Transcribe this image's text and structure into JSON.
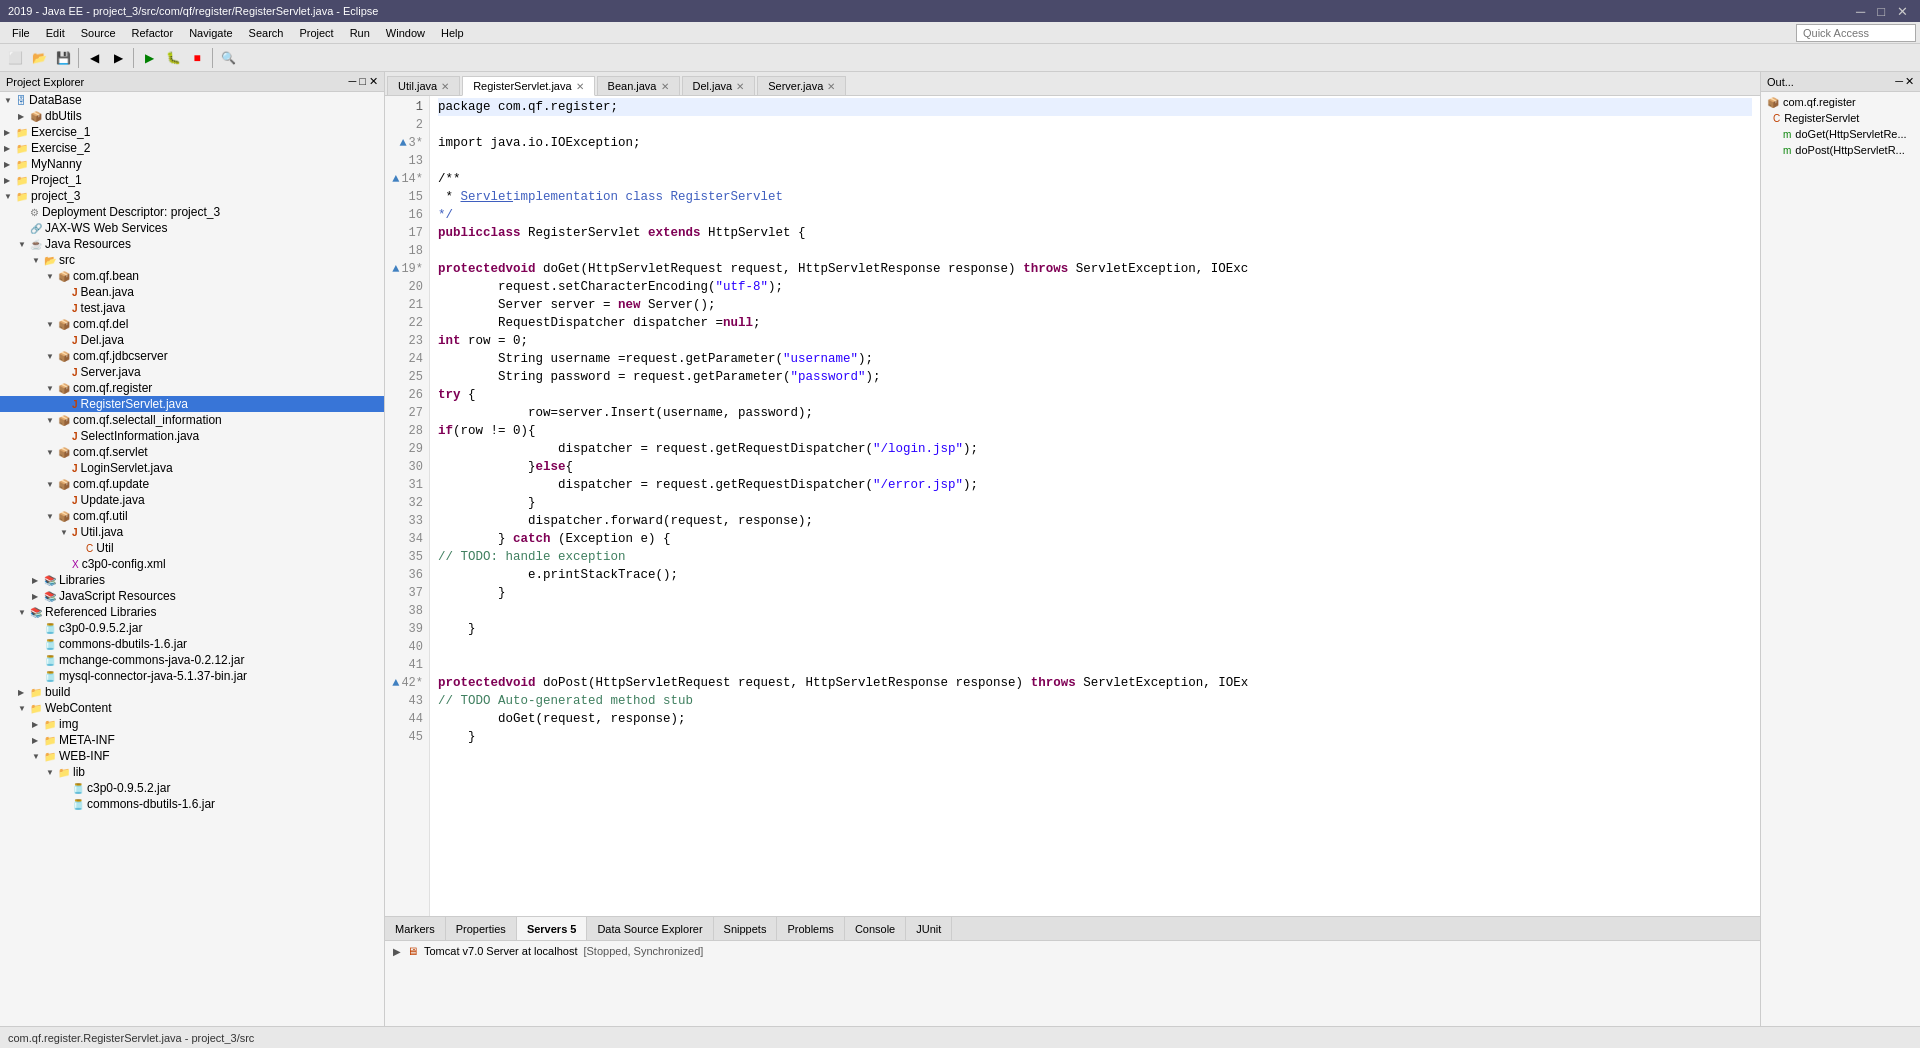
{
  "titleBar": {
    "title": "2019 - Java EE - project_3/src/com/qf/register/RegisterServlet.java - Eclipse",
    "controls": [
      "─",
      "□",
      "✕"
    ]
  },
  "menuBar": {
    "items": [
      "File",
      "Edit",
      "Source",
      "Refactor",
      "Navigate",
      "Search",
      "Project",
      "Run",
      "Window",
      "Help"
    ]
  },
  "quickAccess": {
    "placeholder": "Quick Access"
  },
  "editorTabs": [
    {
      "label": "Util.java",
      "active": false,
      "dirty": false
    },
    {
      "label": "RegisterServlet.java",
      "active": true,
      "dirty": false
    },
    {
      "label": "Bean.java",
      "active": false,
      "dirty": false
    },
    {
      "label": "Del.java",
      "active": false,
      "dirty": false
    },
    {
      "label": "Server.java",
      "active": false,
      "dirty": false
    }
  ],
  "leftPanelTitle": "Project Explorer",
  "projectTree": [
    {
      "indent": 1,
      "arrow": "▼",
      "icon": "db",
      "label": "DataBase",
      "level": 1
    },
    {
      "indent": 2,
      "arrow": "▶",
      "icon": "pkg",
      "label": "dbUtils",
      "level": 2
    },
    {
      "indent": 1,
      "arrow": "▶",
      "icon": "proj",
      "label": "Exercise_1",
      "level": 1
    },
    {
      "indent": 1,
      "arrow": "▶",
      "icon": "proj",
      "label": "Exercise_2",
      "level": 1
    },
    {
      "indent": 1,
      "arrow": "▶",
      "icon": "proj",
      "label": "MyNanny",
      "level": 1
    },
    {
      "indent": 1,
      "arrow": "▶",
      "icon": "proj",
      "label": "Project_1",
      "level": 1
    },
    {
      "indent": 1,
      "arrow": "▼",
      "icon": "proj",
      "label": "project_3",
      "level": 1
    },
    {
      "indent": 2,
      "arrow": " ",
      "icon": "dd",
      "label": "Deployment Descriptor: project_3",
      "level": 2
    },
    {
      "indent": 2,
      "arrow": " ",
      "icon": "ws",
      "label": "JAX-WS Web Services",
      "level": 2
    },
    {
      "indent": 2,
      "arrow": "▼",
      "icon": "jr",
      "label": "Java Resources",
      "level": 2
    },
    {
      "indent": 3,
      "arrow": "▼",
      "icon": "src",
      "label": "src",
      "level": 3
    },
    {
      "indent": 4,
      "arrow": "▼",
      "icon": "pkg",
      "label": "com.qf.bean",
      "level": 4
    },
    {
      "indent": 5,
      "arrow": " ",
      "icon": "java",
      "label": "Bean.java",
      "level": 5
    },
    {
      "indent": 5,
      "arrow": " ",
      "icon": "java",
      "label": "test.java",
      "level": 5
    },
    {
      "indent": 4,
      "arrow": "▼",
      "icon": "pkg",
      "label": "com.qf.del",
      "level": 4
    },
    {
      "indent": 5,
      "arrow": " ",
      "icon": "java",
      "label": "Del.java",
      "level": 5
    },
    {
      "indent": 4,
      "arrow": "▼",
      "icon": "pkg",
      "label": "com.qf.jdbcserver",
      "level": 4
    },
    {
      "indent": 5,
      "arrow": " ",
      "icon": "java",
      "label": "Server.java",
      "level": 5
    },
    {
      "indent": 4,
      "arrow": "▼",
      "icon": "pkg",
      "label": "com.qf.register",
      "level": 4
    },
    {
      "indent": 5,
      "arrow": " ",
      "icon": "java",
      "label": "RegisterServlet.java",
      "level": 5,
      "selected": true
    },
    {
      "indent": 4,
      "arrow": "▼",
      "icon": "pkg",
      "label": "com.qf.selectall_information",
      "level": 4
    },
    {
      "indent": 5,
      "arrow": " ",
      "icon": "java",
      "label": "SelectInformation.java",
      "level": 5
    },
    {
      "indent": 4,
      "arrow": "▼",
      "icon": "pkg",
      "label": "com.qf.servlet",
      "level": 4
    },
    {
      "indent": 5,
      "arrow": " ",
      "icon": "java",
      "label": "LoginServlet.java",
      "level": 5
    },
    {
      "indent": 4,
      "arrow": "▼",
      "icon": "pkg",
      "label": "com.qf.update",
      "level": 4
    },
    {
      "indent": 5,
      "arrow": " ",
      "icon": "java",
      "label": "Update.java",
      "level": 5
    },
    {
      "indent": 4,
      "arrow": "▼",
      "icon": "pkg",
      "label": "com.qf.util",
      "level": 4
    },
    {
      "indent": 5,
      "arrow": "▼",
      "icon": "java",
      "label": "Util.java",
      "level": 5
    },
    {
      "indent": 6,
      "arrow": " ",
      "icon": "cls",
      "label": "Util",
      "level": 6
    },
    {
      "indent": 5,
      "arrow": " ",
      "icon": "xml",
      "label": "c3p0-config.xml",
      "level": 5
    },
    {
      "indent": 3,
      "arrow": "▶",
      "icon": "lib",
      "label": "Libraries",
      "level": 3
    },
    {
      "indent": 3,
      "arrow": "▶",
      "icon": "lib",
      "label": "JavaScript Resources",
      "level": 3
    },
    {
      "indent": 2,
      "arrow": "▼",
      "icon": "reflib",
      "label": "Referenced Libraries",
      "level": 2
    },
    {
      "indent": 3,
      "arrow": " ",
      "icon": "jar",
      "label": "c3p0-0.9.5.2.jar",
      "level": 3
    },
    {
      "indent": 3,
      "arrow": " ",
      "icon": "jar",
      "label": "commons-dbutils-1.6.jar",
      "level": 3
    },
    {
      "indent": 3,
      "arrow": " ",
      "icon": "jar",
      "label": "mchange-commons-java-0.2.12.jar",
      "level": 3
    },
    {
      "indent": 3,
      "arrow": " ",
      "icon": "jar",
      "label": "mysql-connector-java-5.1.37-bin.jar",
      "level": 3
    },
    {
      "indent": 2,
      "arrow": "▶",
      "icon": "folder",
      "label": "build",
      "level": 2
    },
    {
      "indent": 2,
      "arrow": "▼",
      "icon": "folder",
      "label": "WebContent",
      "level": 2
    },
    {
      "indent": 3,
      "arrow": "▶",
      "icon": "folder",
      "label": "img",
      "level": 3
    },
    {
      "indent": 3,
      "arrow": "▶",
      "icon": "folder",
      "label": "META-INF",
      "level": 3
    },
    {
      "indent": 3,
      "arrow": "▼",
      "icon": "folder",
      "label": "WEB-INF",
      "level": 3
    },
    {
      "indent": 4,
      "arrow": "▼",
      "icon": "folder",
      "label": "lib",
      "level": 4
    },
    {
      "indent": 5,
      "arrow": " ",
      "icon": "jar",
      "label": "c3p0-0.9.5.2.jar",
      "level": 5
    },
    {
      "indent": 5,
      "arrow": " ",
      "icon": "jar",
      "label": "commons-dbutils-1.6.jar",
      "level": 5
    }
  ],
  "codeLines": [
    {
      "num": 1,
      "text": "package com.qf.register;",
      "highlight": true
    },
    {
      "num": 2,
      "text": ""
    },
    {
      "num": 3,
      "text": "import java.io.IOException;",
      "fold": true
    },
    {
      "num": 13,
      "text": ""
    },
    {
      "num": 14,
      "text": "/**",
      "fold": true
    },
    {
      "num": 15,
      "text": " * Servlet implementation class RegisterServlet"
    },
    {
      "num": 16,
      "text": " */"
    },
    {
      "num": 17,
      "text": "public class RegisterServlet extends HttpServlet {"
    },
    {
      "num": 18,
      "text": ""
    },
    {
      "num": 19,
      "text": "    protected void doGet(HttpServletRequest request, HttpServletResponse response) throws ServletException, IOExc",
      "fold": true
    },
    {
      "num": 20,
      "text": "        request.setCharacterEncoding(\"utf-8\");"
    },
    {
      "num": 21,
      "text": "        Server server = new Server();"
    },
    {
      "num": 22,
      "text": "        RequestDispatcher dispatcher =null;"
    },
    {
      "num": 23,
      "text": "        int row = 0;"
    },
    {
      "num": 24,
      "text": "        String username =request.getParameter(\"username\");"
    },
    {
      "num": 25,
      "text": "        String password = request.getParameter(\"password\");"
    },
    {
      "num": 26,
      "text": "        try {"
    },
    {
      "num": 27,
      "text": "            row=server.Insert(username, password);"
    },
    {
      "num": 28,
      "text": "            if(row != 0){"
    },
    {
      "num": 29,
      "text": "                dispatcher = request.getRequestDispatcher(\"/login.jsp\");"
    },
    {
      "num": 30,
      "text": "            }else{"
    },
    {
      "num": 31,
      "text": "                dispatcher = request.getRequestDispatcher(\"/error.jsp\");"
    },
    {
      "num": 32,
      "text": "            }"
    },
    {
      "num": 33,
      "text": "            dispatcher.forward(request, response);"
    },
    {
      "num": 34,
      "text": "        } catch (Exception e) {"
    },
    {
      "num": 35,
      "text": "            // TODO: handle exception"
    },
    {
      "num": 36,
      "text": "            e.printStackTrace();"
    },
    {
      "num": 37,
      "text": "        }"
    },
    {
      "num": 38,
      "text": ""
    },
    {
      "num": 39,
      "text": "    }"
    },
    {
      "num": 40,
      "text": ""
    },
    {
      "num": 41,
      "text": ""
    },
    {
      "num": 42,
      "text": "    protected void doPost(HttpServletRequest request, HttpServletResponse response) throws ServletException, IOEx",
      "fold": true
    },
    {
      "num": 43,
      "text": "        // TODO Auto-generated method stub"
    },
    {
      "num": 44,
      "text": "        doGet(request, response);"
    },
    {
      "num": 45,
      "text": "    }"
    }
  ],
  "bottomTabs": [
    {
      "label": "Markers",
      "active": false
    },
    {
      "label": "Properties",
      "active": false
    },
    {
      "label": "Servers",
      "active": true,
      "badge": "5"
    },
    {
      "label": "Data Source Explorer",
      "active": false
    },
    {
      "label": "Snippets",
      "active": false
    },
    {
      "label": "Problems",
      "active": false
    },
    {
      "label": "Console",
      "active": false
    },
    {
      "label": "JUnit",
      "active": false
    }
  ],
  "serverItem": {
    "icon": "server",
    "label": "Tomcat v7.0 Server at localhost",
    "status": "[Stopped, Synchronized]"
  },
  "rightPanelTitle": "Out...",
  "outlineItems": [
    {
      "label": "com.qf.register",
      "icon": "pkg",
      "indent": 0
    },
    {
      "label": "RegisterServlet",
      "icon": "cls",
      "indent": 1
    },
    {
      "label": "doGet(HttpServletRe...",
      "icon": "method",
      "indent": 2
    },
    {
      "label": "doPost(HttpServletR...",
      "icon": "method",
      "indent": 2
    }
  ],
  "statusBar": {
    "text": "com.qf.register.RegisterServlet.java - project_3/src"
  }
}
